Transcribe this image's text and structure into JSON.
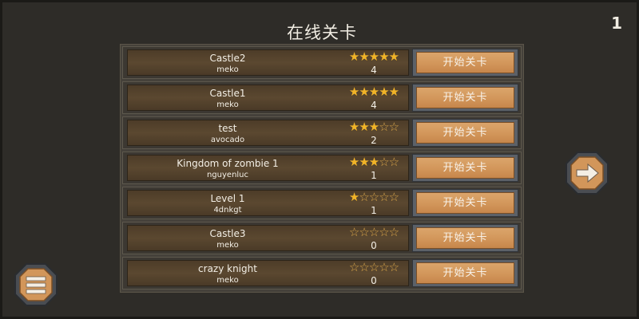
{
  "header": {
    "title": "在线关卡",
    "page_indicator": "1"
  },
  "levels": [
    {
      "name": "Castle2",
      "author": "meko",
      "stars": 5,
      "score": "4",
      "stars_text": "★★★★★",
      "stars_off_text": "",
      "button_label": "开始关卡"
    },
    {
      "name": "Castle1",
      "author": "meko",
      "stars": 5,
      "score": "4",
      "stars_text": "★★★★★",
      "stars_off_text": "",
      "button_label": "开始关卡"
    },
    {
      "name": "test",
      "author": "avocado",
      "stars": 3,
      "score": "2",
      "stars_text": "★★★",
      "stars_off_text": "☆☆",
      "button_label": "开始关卡"
    },
    {
      "name": "Kingdom of zombie 1",
      "author": "nguyenluc",
      "stars": 3,
      "score": "1",
      "stars_text": "★★★",
      "stars_off_text": "☆☆",
      "button_label": "开始关卡"
    },
    {
      "name": "Level 1",
      "author": "4dnkgt",
      "stars": 1,
      "score": "1",
      "stars_text": "★",
      "stars_off_text": "☆☆☆☆",
      "button_label": "开始关卡"
    },
    {
      "name": "Castle3",
      "author": "meko",
      "stars": 0,
      "score": "0",
      "stars_text": "",
      "stars_off_text": "☆☆☆☆☆",
      "button_label": "开始关卡"
    },
    {
      "name": "crazy knight",
      "author": "meko",
      "stars": 0,
      "score": "0",
      "stars_text": "",
      "stars_off_text": "☆☆☆☆☆",
      "button_label": "开始关卡"
    }
  ],
  "icons": {
    "next": "arrow-right-icon",
    "menu": "menu-icon"
  },
  "colors": {
    "star": "#f1b428",
    "button": "#d2965a",
    "row_panel": "#5b4830"
  }
}
